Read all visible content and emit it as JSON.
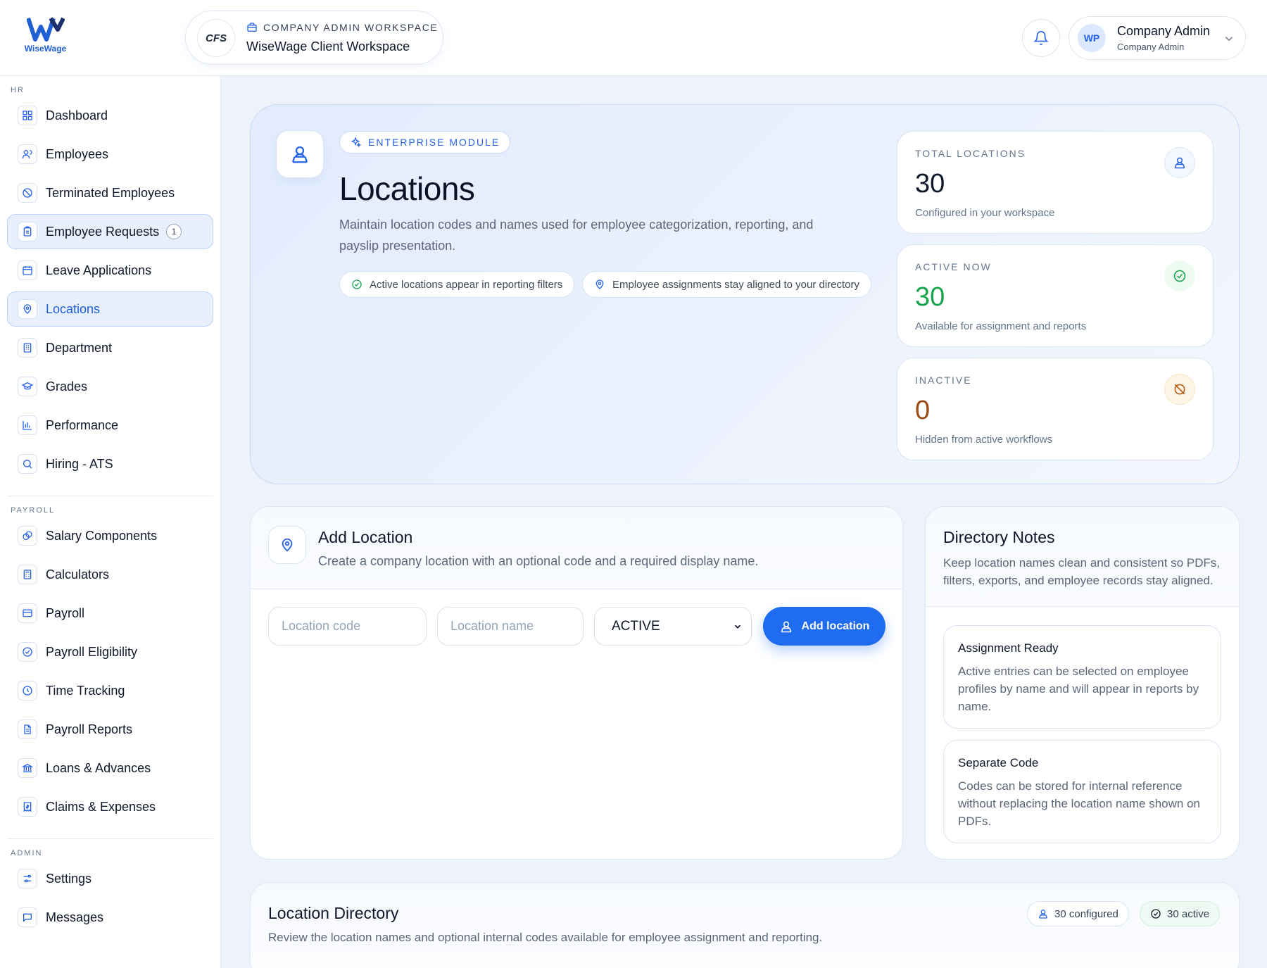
{
  "brand": {
    "name": "WiseWage",
    "accent": "#2563eb"
  },
  "workspace": {
    "logo_text": "CFS",
    "kicker": "COMPANY ADMIN WORKSPACE",
    "title": "WiseWage Client Workspace"
  },
  "user": {
    "initials": "WP",
    "name": "Company Admin",
    "role": "Company Admin"
  },
  "sidebar": {
    "sections": [
      {
        "label": "HR",
        "items": [
          {
            "label": "Dashboard",
            "icon": "grid-icon"
          },
          {
            "label": "Employees",
            "icon": "users-icon"
          },
          {
            "label": "Terminated Employees",
            "icon": "ban-icon"
          },
          {
            "label": "Employee Requests",
            "icon": "clipboard-icon",
            "badge": "1",
            "state": "highlighted"
          },
          {
            "label": "Leave Applications",
            "icon": "calendar-icon"
          },
          {
            "label": "Locations",
            "icon": "map-pin-icon",
            "state": "current"
          },
          {
            "label": "Department",
            "icon": "building-icon"
          },
          {
            "label": "Grades",
            "icon": "graduation-cap-icon"
          },
          {
            "label": "Performance",
            "icon": "bar-chart-icon"
          },
          {
            "label": "Hiring - ATS",
            "icon": "search-icon"
          }
        ]
      },
      {
        "label": "PAYROLL",
        "items": [
          {
            "label": "Salary Components",
            "icon": "coins-icon"
          },
          {
            "label": "Calculators",
            "icon": "calculator-icon"
          },
          {
            "label": "Payroll",
            "icon": "credit-card-icon"
          },
          {
            "label": "Payroll Eligibility",
            "icon": "check-circle-icon"
          },
          {
            "label": "Time Tracking",
            "icon": "clock-icon"
          },
          {
            "label": "Payroll Reports",
            "icon": "file-text-icon"
          },
          {
            "label": "Loans & Advances",
            "icon": "bank-icon"
          },
          {
            "label": "Claims & Expenses",
            "icon": "receipt-icon"
          }
        ]
      },
      {
        "label": "ADMIN",
        "items": [
          {
            "label": "Settings",
            "icon": "sliders-icon"
          },
          {
            "label": "Messages",
            "icon": "message-icon"
          }
        ]
      }
    ]
  },
  "hero": {
    "kicker": "ENTERPRISE MODULE",
    "title": "Locations",
    "description": "Maintain location codes and names used for employee categorization, reporting, and payslip presentation.",
    "chips": [
      "Active locations appear in reporting filters",
      "Employee assignments stay aligned to your directory"
    ]
  },
  "stats": [
    {
      "title": "TOTAL LOCATIONS",
      "value": "30",
      "subtitle": "Configured in your workspace",
      "color": "#0f172a",
      "icon": "map-user-icon"
    },
    {
      "title": "ACTIVE NOW",
      "value": "30",
      "subtitle": "Available for assignment and reports",
      "color": "#16a34a",
      "icon": "check-circle-icon"
    },
    {
      "title": "INACTIVE",
      "value": "0",
      "subtitle": "Hidden from active workflows",
      "color": "#9a4a12",
      "icon": "eye-off-icon"
    }
  ],
  "add_location": {
    "title": "Add Location",
    "subtitle": "Create a company location with an optional code and a required display name.",
    "code_placeholder": "Location code",
    "name_placeholder": "Location name",
    "status_value": "ACTIVE",
    "button_label": "Add location"
  },
  "notes": {
    "title": "Directory Notes",
    "subtitle": "Keep location names clean and consistent so PDFs, filters, exports, and employee records stay aligned.",
    "items": [
      {
        "title": "Assignment Ready",
        "body": "Active entries can be selected on employee profiles by name and will appear in reports by name."
      },
      {
        "title": "Separate Code",
        "body": "Codes can be stored for internal reference without replacing the location name shown on PDFs."
      }
    ]
  },
  "directory": {
    "title": "Location Directory",
    "subtitle": "Review the location names and optional internal codes available for employee assignment and reporting.",
    "configured_label": "30 configured",
    "active_label": "30 active"
  }
}
